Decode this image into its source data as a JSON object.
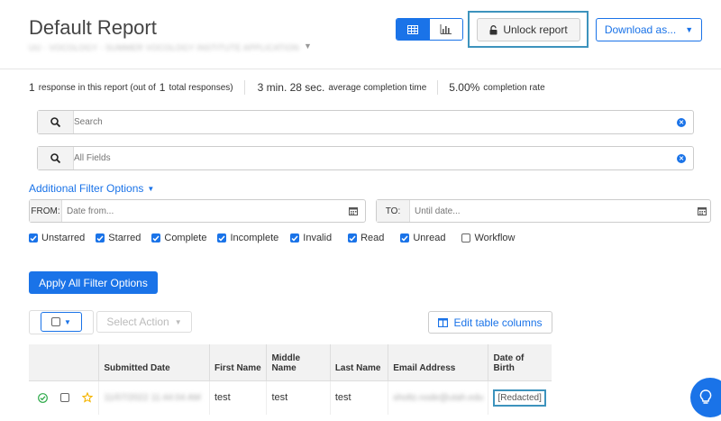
{
  "header": {
    "title": "Default Report",
    "subtitle": "UU - VOCOLOGY - SUMMER VOCOLOGY INSTITUTE APPLICATION",
    "unlock_label": "Unlock report",
    "download_label": "Download as..."
  },
  "stats": {
    "responses_count": "1",
    "responses_text_a": "response in this report (out of",
    "responses_total": "1",
    "responses_text_b": "total responses)",
    "avg_time": "3 min. 28 sec.",
    "avg_time_label": "average completion time",
    "completion_rate": "5.00%",
    "completion_rate_label": "completion rate"
  },
  "filters": {
    "search_placeholder": "Search",
    "fields_placeholder": "All Fields",
    "additional_label": "Additional Filter Options",
    "from_label": "FROM:",
    "from_placeholder": "Date from...",
    "to_label": "TO:",
    "to_placeholder": "Until date...",
    "checkboxes": [
      {
        "label": "Unstarred",
        "checked": true
      },
      {
        "label": "Starred",
        "checked": true
      },
      {
        "label": "Complete",
        "checked": true
      },
      {
        "label": "Incomplete",
        "checked": true
      },
      {
        "label": "Invalid",
        "checked": true
      },
      {
        "label": "Read",
        "checked": true
      },
      {
        "label": "Unread",
        "checked": true
      },
      {
        "label": "Workflow",
        "checked": false
      }
    ],
    "apply_label": "Apply All Filter Options"
  },
  "toolbar": {
    "select_action_label": "Select Action",
    "edit_columns_label": "Edit table columns"
  },
  "table": {
    "columns": [
      "Submitted Date",
      "First Name",
      "Middle Name",
      "Last Name",
      "Email Address",
      "Date of Birth"
    ],
    "rows": [
      {
        "submitted": "11/07/2022 11:44:04 AM",
        "first": "test",
        "middle": "test",
        "last": "test",
        "email": "sholtz.node@utah.edu",
        "dob": "[Redacted]"
      }
    ]
  },
  "colors": {
    "accent": "#1a73e8",
    "highlight_border": "#3d93bd",
    "complete_green": "#2eaa4a",
    "star_yellow": "#f5b400"
  }
}
